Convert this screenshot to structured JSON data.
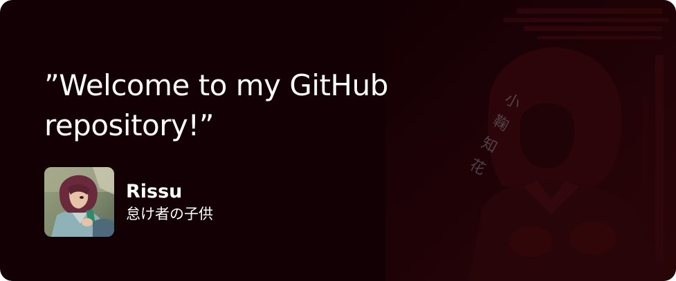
{
  "card": {
    "quote": "”Welcome to my GitHub repository!”",
    "author": {
      "name": "Rissu",
      "subtitle": "怠け者の子供"
    },
    "background_text": "小鞠知花",
    "colors": {
      "background": "#130004",
      "text": "#ffffff",
      "background_art": "#2a0508",
      "background_text": "#5a4d52"
    },
    "icons": {
      "avatar": "anime-character-avatar",
      "background_art": "anime-character-illustration"
    }
  }
}
